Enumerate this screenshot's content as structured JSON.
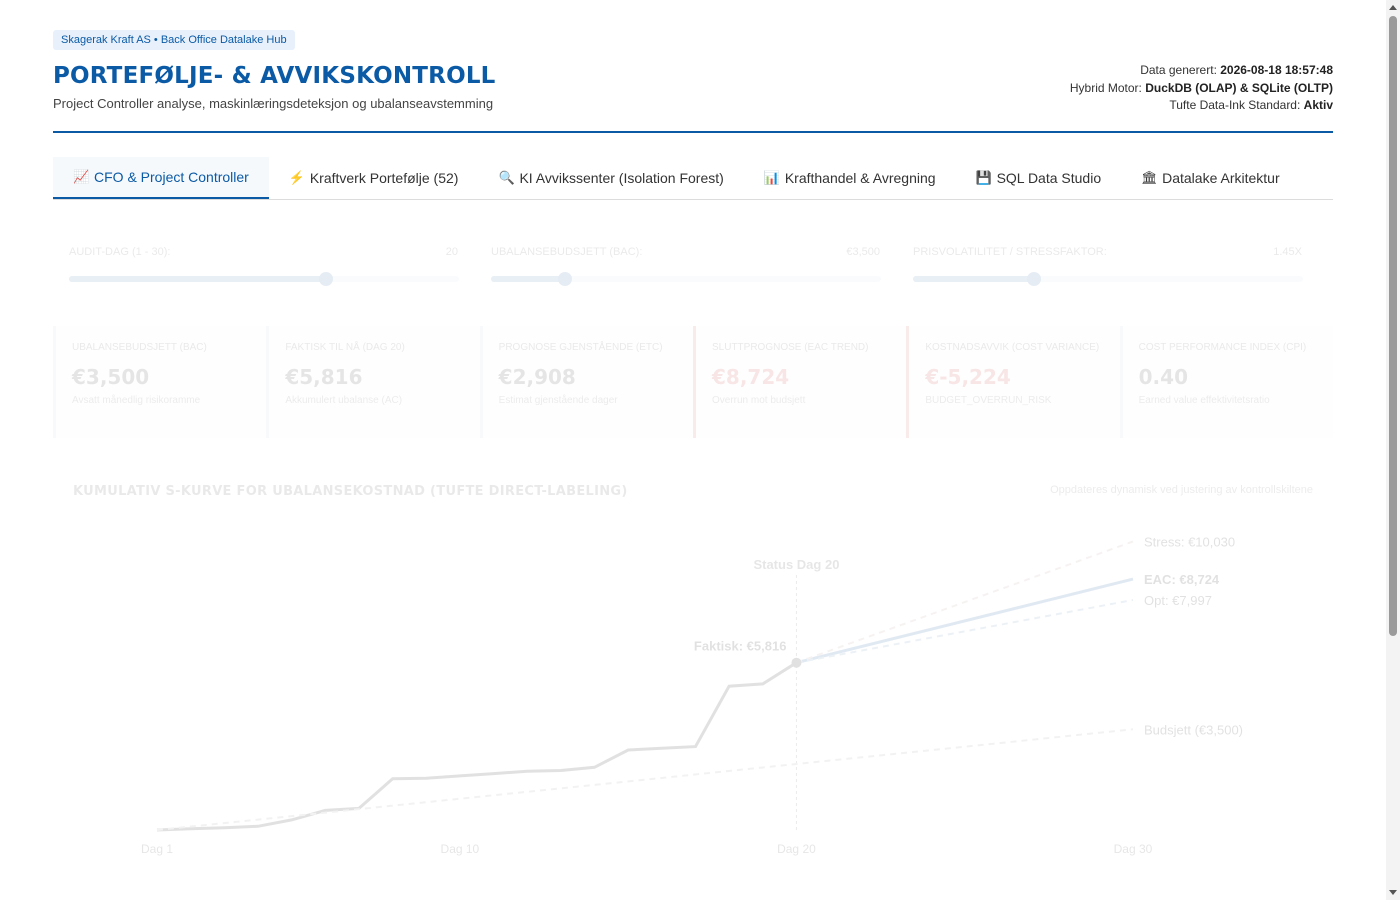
{
  "header": {
    "brand": "Skagerak Kraft AS • Back Office Datalake Hub",
    "title": "PORTEFØLJE- & AVVIKSKONTROLL",
    "subtitle": "Project Controller analyse, maskinlæringsdeteksjon og ubalanseavstemming",
    "meta": {
      "generated_label": "Data generert: ",
      "generated_value": "2026-08-18 18:57:48",
      "engine_label": "Hybrid Motor: ",
      "engine_value": "DuckDB (OLAP) & SQLite (OLTP)",
      "standard_label": "Tufte Data-Ink Standard: ",
      "standard_value": "Aktiv"
    }
  },
  "tabs": [
    {
      "icon": "chart-icon",
      "glyph": "📈",
      "label": "CFO & Project Controller",
      "active": true
    },
    {
      "icon": "lightning-icon",
      "glyph": "⚡",
      "label": "Kraftverk Portefølje (52)",
      "active": false
    },
    {
      "icon": "search-icon",
      "glyph": "🔍",
      "label": "KI Avvikssenter (Isolation Forest)",
      "active": false
    },
    {
      "icon": "bar-chart-icon",
      "glyph": "📊",
      "label": "Krafthandel & Avregning",
      "active": false
    },
    {
      "icon": "floppy-disk-icon",
      "glyph": "💾",
      "label": "SQL Data Studio",
      "active": false
    },
    {
      "icon": "building-icon",
      "glyph": "🏛",
      "label": "Datalake Arkitektur",
      "active": false
    }
  ],
  "sliders": [
    {
      "label": "AUDIT-DAG (1 - 30):",
      "value": "20",
      "fraction": 0.66
    },
    {
      "label": "UBALANSEBUDSJETT (BAC):",
      "value": "€3,500",
      "fraction": 0.19
    },
    {
      "label": "PRISVOLATILITET / STRESSFAKTOR:",
      "value": "1.45X",
      "fraction": 0.31
    }
  ],
  "kpis": [
    {
      "label": "UBALANSEBUDSJETT (BAC)",
      "value": "€3,500",
      "sub": "Avsatt månedlig risikoramme",
      "red": false
    },
    {
      "label": "FAKTISK TIL NÅ (DAG 20)",
      "value": "€5,816",
      "sub": "Akkumulert ubalanse (AC)",
      "red": false
    },
    {
      "label": "PROGNOSE GJENSTÅENDE (ETC)",
      "value": "€2,908",
      "sub": "Estimat gjenstående dager",
      "red": false
    },
    {
      "label": "SLUTTPROGNOSE (EAC TREND)",
      "value": "€8,724",
      "sub": "Overrun mot budsjett",
      "red": true
    },
    {
      "label": "KOSTNADSAVVIK (COST VARIANCE)",
      "value": "€-5,224",
      "sub": "BUDGET_OVERRUN_RISK",
      "red": true
    },
    {
      "label": "COST PERFORMANCE INDEX (CPI)",
      "value": "0.40",
      "sub": "Earned value effektivitetsratio",
      "red": false
    }
  ],
  "chart_header": {
    "title": "KUMULATIV S-KURVE FOR UBALANSEKOSTNAD (TUFTE DIRECT-LABELING)",
    "note": "Oppdateres dynamisk ved justering av kontrollskiltene"
  },
  "chart_data": {
    "type": "line",
    "x_ticks": [
      1,
      10,
      20,
      30
    ],
    "x_tick_labels": [
      "Dag 1",
      "Dag 10",
      "Dag 20",
      "Dag 30"
    ],
    "xlim": [
      1,
      30
    ],
    "ylim": [
      0,
      10500
    ],
    "grid": false,
    "legend": "direct-labels",
    "status_label": "Status Dag 20",
    "status_day": 20,
    "series": [
      {
        "name": "Faktisk",
        "label": "Faktisk: €5,816",
        "style": "solid",
        "color": "#8a8a8a",
        "x": [
          1,
          2,
          3,
          4,
          5,
          6,
          7,
          8,
          9,
          10,
          11,
          12,
          13,
          14,
          15,
          16,
          17,
          18,
          19,
          20
        ],
        "y": [
          0,
          40,
          80,
          130,
          350,
          680,
          750,
          1780,
          1800,
          1880,
          1960,
          2040,
          2070,
          2180,
          2780,
          2840,
          2900,
          5000,
          5080,
          5816
        ]
      },
      {
        "name": "EAC",
        "label": "EAC: €8,724",
        "style": "solid",
        "color": "#2f6aa6",
        "x": [
          20,
          30
        ],
        "y": [
          5816,
          8724
        ]
      },
      {
        "name": "Stress",
        "label": "Stress: €10,030",
        "style": "dashed",
        "color": "#c9a9a9",
        "x": [
          20,
          30
        ],
        "y": [
          5816,
          10030
        ]
      },
      {
        "name": "Opt",
        "label": "Opt: €7,997",
        "style": "dashed",
        "color": "#7fa0c4",
        "x": [
          20,
          30
        ],
        "y": [
          5816,
          7997
        ]
      },
      {
        "name": "Budsjett",
        "label": "Budsjett (€3,500)",
        "style": "dashed",
        "color": "#a8a8a8",
        "x": [
          1,
          30
        ],
        "y": [
          0,
          3500
        ]
      }
    ]
  }
}
